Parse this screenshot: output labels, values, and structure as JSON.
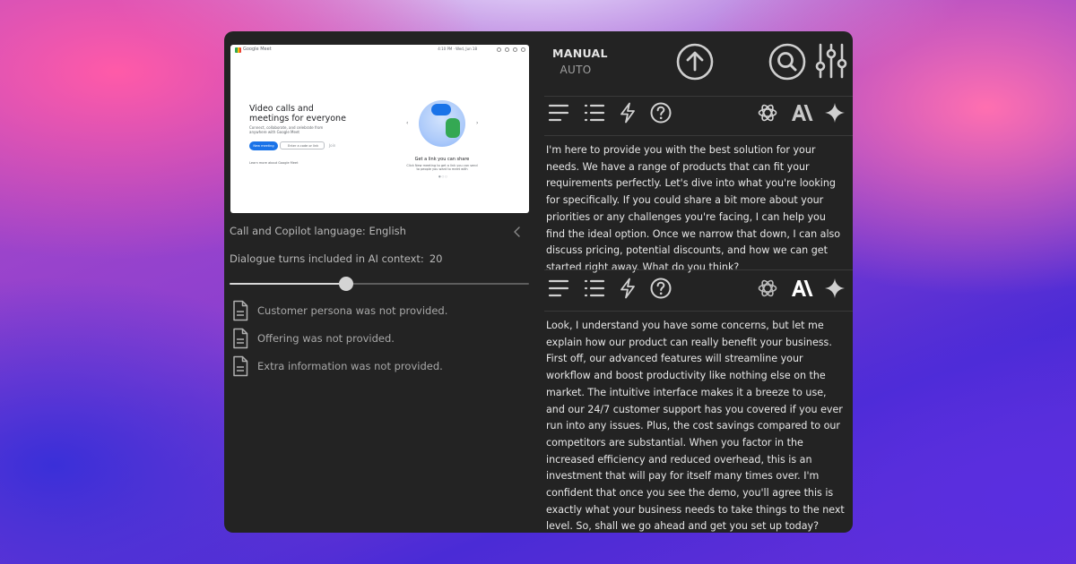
{
  "preview": {
    "brand": "Google Meet",
    "clock": "4:10 PM · Wed, Jun 18",
    "heading": "Video calls and meetings for everyone",
    "subheading": "Connect, collaborate, and celebrate from anywhere with Google Meet",
    "new_meeting": "New meeting",
    "code_placeholder": "Enter a code or link",
    "join": "Join",
    "learn_more": "Learn more about Google Meet",
    "caption": "Get a link you can share",
    "caption_sub": "Click New meeting to get a link you can send to people you want to meet with",
    "pager": "● ○ ○"
  },
  "settings": {
    "language_label": "Call and Copilot language: English",
    "turns_label": "Dialogue turns included in AI context:",
    "turns_value": "20",
    "turns_fraction": 0.39
  },
  "info": [
    {
      "text": "Customer persona was not provided."
    },
    {
      "text": "Offering was not provided."
    },
    {
      "text": "Extra information was not provided."
    }
  ],
  "mode": {
    "manual": "MANUAL",
    "auto": "AUTO"
  },
  "icons": {
    "upload": "arrow-up-circle-icon",
    "search": "search-icon",
    "settings": "sliders-icon",
    "toolbar": [
      "text-lines-icon",
      "list-icon",
      "lightning-icon",
      "help-icon",
      "openai-icon",
      "anthropic-icon",
      "gemini-sparkle-icon"
    ]
  },
  "responses": [
    {
      "provider_active": "openai",
      "text": "I'm here to provide you with the best solution for your needs. We have a range of products that can fit your requirements perfectly. Let's dive into what you're looking for specifically. If you could share a bit more about your priorities or any challenges you're facing, I can help you find the ideal option. Once we narrow that down, I can also discuss pricing, potential discounts, and how we can get started right away. What do you think?"
    },
    {
      "provider_active": "anthropic",
      "text": "Look, I understand you have some concerns, but let me explain how our product can really benefit your business. First off, our advanced features will streamline your workflow and boost productivity like nothing else on the market. The intuitive interface makes it a breeze to use, and our 24/7 customer support has you covered if you ever run into any issues. Plus, the cost savings compared to our competitors are substantial. When you factor in the increased efficiency and reduced overhead, this is an investment that will pay for itself many times over. I'm confident that once you see the demo, you'll agree this is exactly what your business needs to take things to the next level. So, shall we go ahead and get you set up today?"
    }
  ],
  "colors": {
    "panel": "#232323",
    "text": "#e8e8e8",
    "muted": "#a8a8a8",
    "icon": "#c8c8c8",
    "icon_active": "#ffffff"
  }
}
